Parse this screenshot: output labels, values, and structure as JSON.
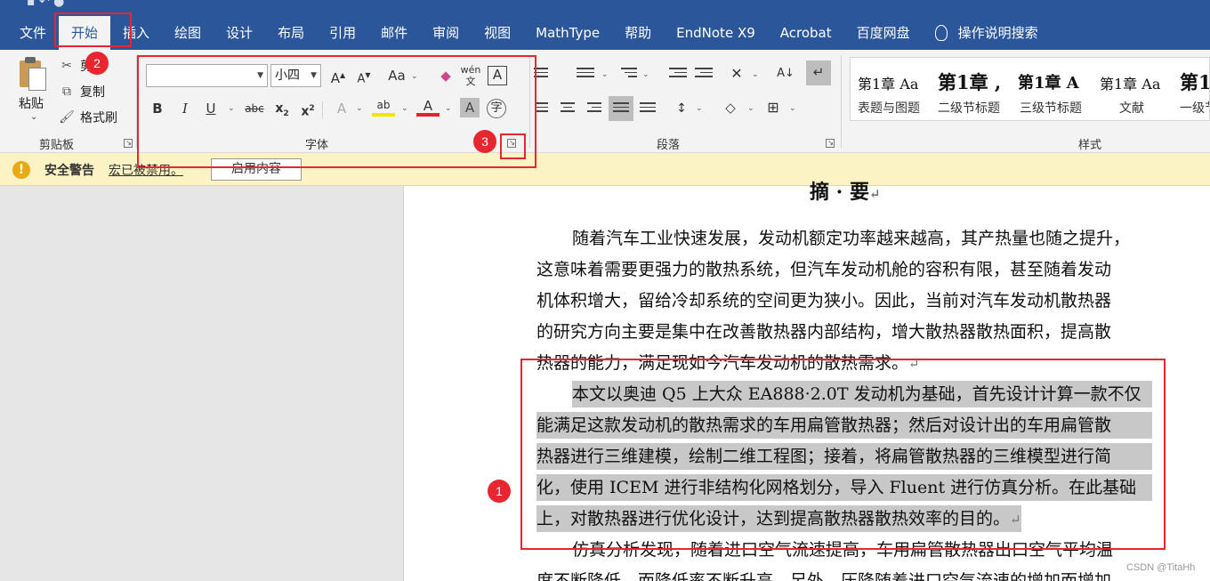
{
  "menu": {
    "tabs": [
      "文件",
      "开始",
      "插入",
      "绘图",
      "设计",
      "布局",
      "引用",
      "邮件",
      "审阅",
      "视图",
      "MathType",
      "帮助",
      "EndNote X9",
      "Acrobat",
      "百度网盘"
    ],
    "active_index": 1,
    "search_label": "操作说明搜索"
  },
  "clipboard": {
    "paste_label": "粘贴",
    "cut_label": "剪",
    "copy_label": "复制",
    "format_painter_label": "格式刷",
    "group_label": "剪贴板"
  },
  "font": {
    "font_name": "",
    "font_size": "小四",
    "group_label": "字体"
  },
  "paragraph": {
    "group_label": "段落"
  },
  "styles": {
    "group_label": "样式",
    "items": [
      {
        "preview": "第1章  Aa",
        "name": "表题与图题"
      },
      {
        "preview": "第1章 ,",
        "name": "二级节标题"
      },
      {
        "preview": "第1章  A",
        "name": "三级节标题"
      },
      {
        "preview": "第1章  Aa",
        "name": "文献"
      },
      {
        "preview": "第1",
        "name": "一级节"
      }
    ]
  },
  "security_bar": {
    "title": "安全警告",
    "message": "宏已被禁用。",
    "button_label": "启用内容"
  },
  "document": {
    "heading": "摘 · 要",
    "paragraph1": [
      "随着汽车工业快速发展，发动机额定功率越来越高，其产热量也随之提升，",
      "这意味着需要更强力的散热系统，但汽车发动机舱的容积有限，甚至随着发动",
      "机体积增大，留给冷却系统的空间更为狭小。因此，当前对汽车发动机散热器",
      "的研究方向主要是集中在改善散热器内部结构，增大散热器散热面积，提高散",
      "热器的能力，满足现如今汽车发动机的散热需求。"
    ],
    "paragraph2": [
      "本文以奥迪 Q5 上大众 EA888·2.0T 发动机为基础，首先设计计算一款不仅",
      "能满足这款发动机的散热需求的车用扁管散热器；然后对设计出的车用扁管散",
      "热器进行三维建模，绘制二维工程图；接着，将扁管散热器的三维模型进行简",
      "化，使用 ICEM 进行非结构化网格划分，导入 Fluent 进行仿真分析。在此基础",
      "上，对散热器进行优化设计，达到提高散热器散热效率的目的。"
    ],
    "paragraph3": [
      "仿真分析发现，随着进口空气流速提高，车用扁管散热器出口空气平均温",
      "度不断降低，而降低率不断升高。另外，压降随着进口空气流速的增加而增加"
    ],
    "paragraph_mark": "↵"
  },
  "annotations": {
    "badge1": "1",
    "badge2": "2",
    "badge3": "3"
  },
  "watermark": "CSDN @TitaHh"
}
